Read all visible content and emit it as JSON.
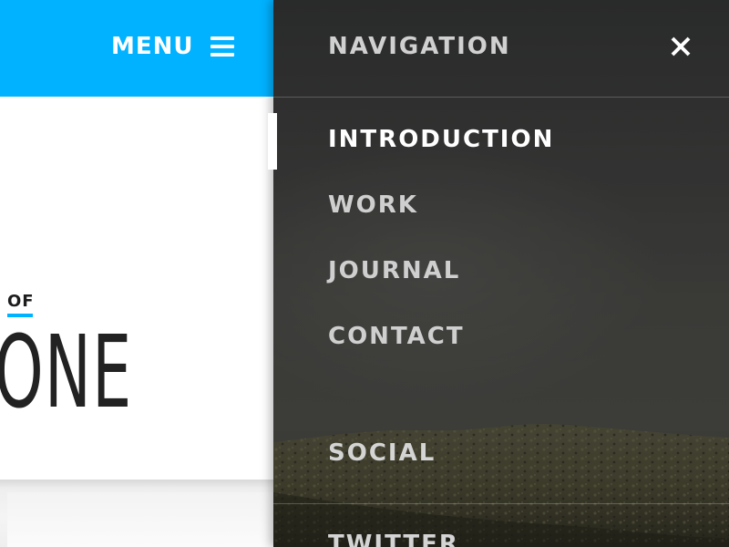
{
  "header": {
    "menu_label": "MENU",
    "menu_icon": "hamburger-icon",
    "accent_color": "#00b2ff"
  },
  "hero": {
    "kicker": "OF",
    "headline_fragment": "ONE"
  },
  "navigation": {
    "title": "NAVIGATION",
    "close_icon": "close-icon",
    "items": [
      {
        "label": "INTRODUCTION",
        "active": true
      },
      {
        "label": "WORK",
        "active": false
      },
      {
        "label": "JOURNAL",
        "active": false
      },
      {
        "label": "CONTACT",
        "active": false
      }
    ],
    "social": {
      "heading": "SOCIAL",
      "links": [
        {
          "label": "TWITTER"
        }
      ]
    }
  }
}
